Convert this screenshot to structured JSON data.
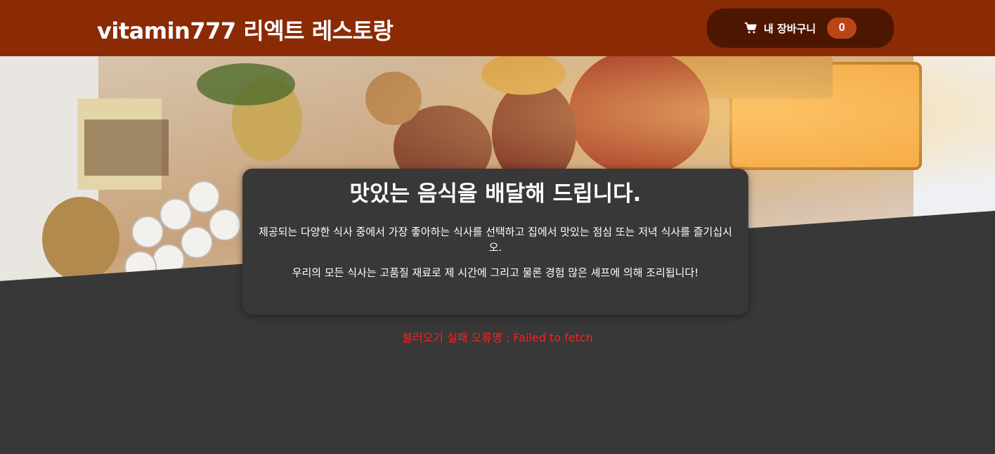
{
  "header": {
    "title": "vitamin777 리엑트 레스토랑",
    "cart": {
      "icon": "cart-icon",
      "label": "내 장바구니",
      "count": "0"
    }
  },
  "hero": {
    "image": "catered-buffet-table-photo"
  },
  "summary": {
    "heading": "맛있는 음식을 배달해 드립니다.",
    "paragraph1": "제공되는 다양한 식사 중에서 가장 좋아하는 식사를 선택하고 집에서 맛있는 점심 또는 저녁 식사를 즐기십시오.",
    "paragraph2": "우리의 모든 식사는 고품질 재료로 제 시간에 그리고 물론 경험 많은 셰프에 의해 조리됩니다!"
  },
  "error": {
    "message": "불러오기 실패 오류명 : Failed to fetch"
  },
  "colors": {
    "header_bg": "#8a2b06",
    "cart_bg": "#4d1601",
    "badge_bg": "#b94517",
    "page_bg": "#383838",
    "error_text": "#ff1f1f"
  }
}
